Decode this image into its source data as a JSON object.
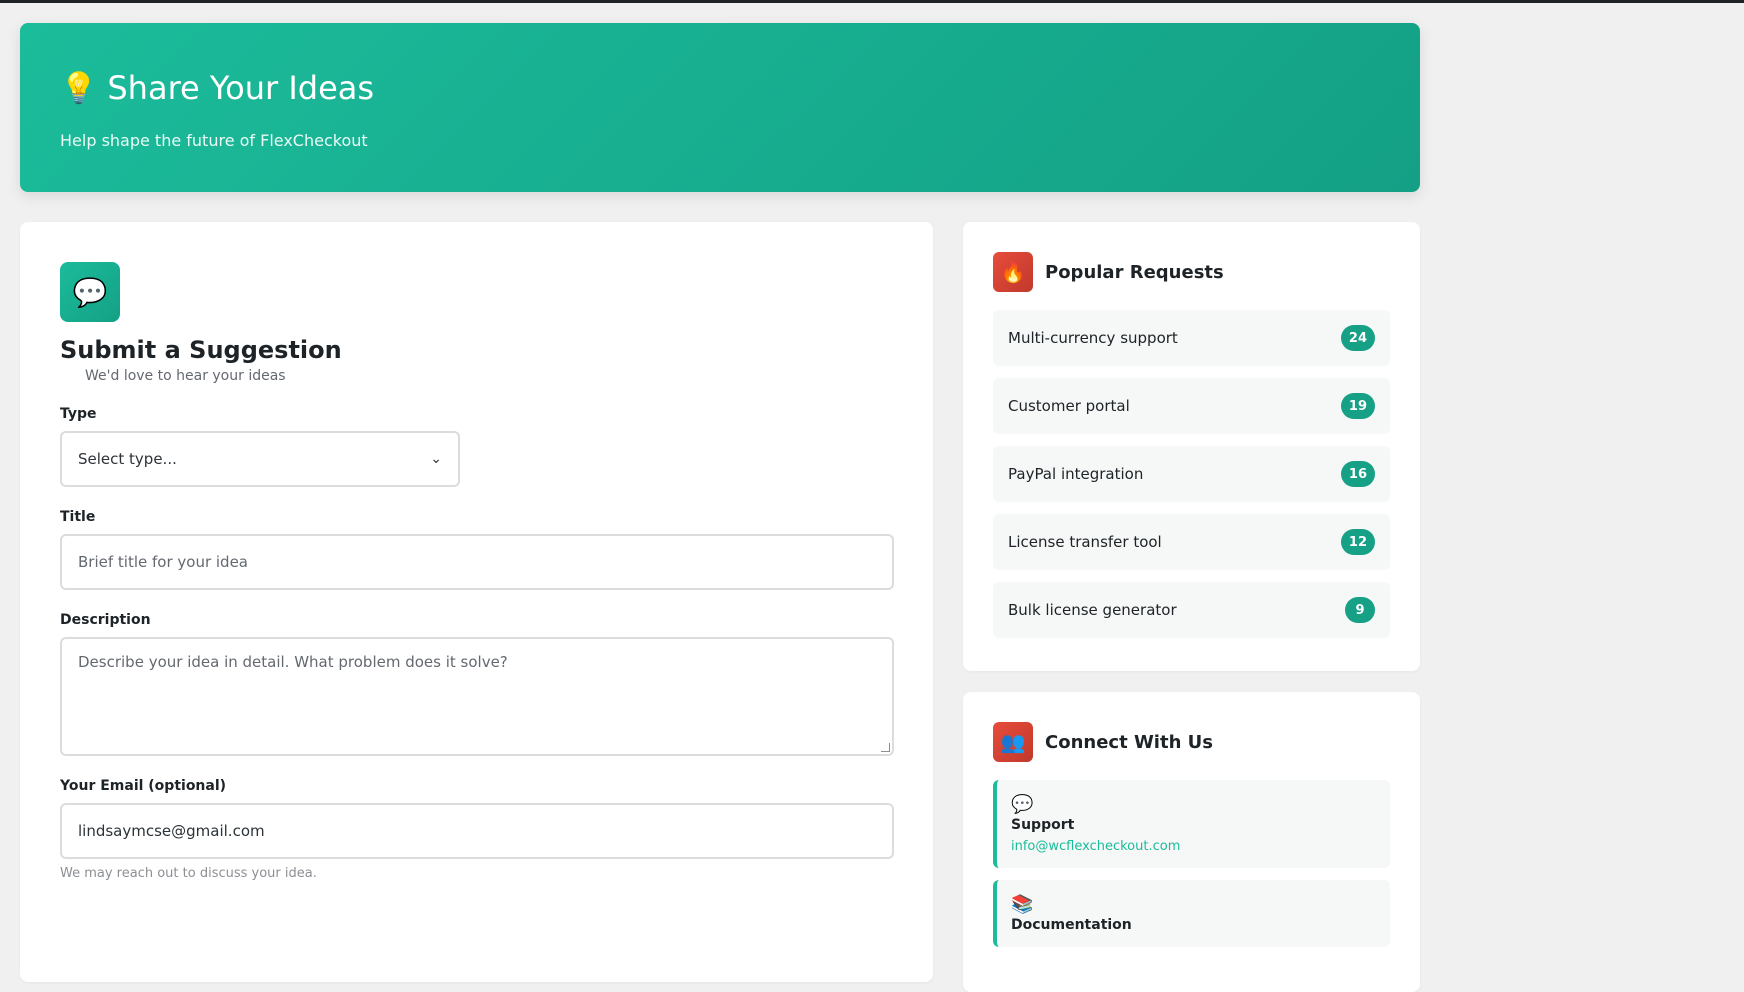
{
  "hero": {
    "emoji": "💡",
    "title": "Share Your Ideas",
    "subtitle": "Help shape the future of FlexCheckout"
  },
  "form": {
    "icon": "💬",
    "heading": "Submit a Suggestion",
    "subheading": "We'd love to hear your ideas",
    "type_label": "Type",
    "type_value": "Select type...",
    "title_label": "Title",
    "title_placeholder": "Brief title for your idea",
    "description_label": "Description",
    "description_placeholder": "Describe your idea in detail. What problem does it solve?",
    "email_label": "Your Email (optional)",
    "email_value": "lindsaymcse@gmail.com",
    "email_help": "We may reach out to discuss your idea."
  },
  "popular": {
    "icon": "🔥",
    "title": "Popular Requests",
    "items": [
      {
        "label": "Multi-currency support",
        "count": "24"
      },
      {
        "label": "Customer portal",
        "count": "19"
      },
      {
        "label": "PayPal integration",
        "count": "16"
      },
      {
        "label": "License transfer tool",
        "count": "12"
      },
      {
        "label": "Bulk license generator",
        "count": "9"
      }
    ]
  },
  "connect": {
    "icon": "👥",
    "title": "Connect With Us",
    "items": [
      {
        "emoji": "💬",
        "name": "Support",
        "link": "info@wcflexcheckout.com"
      },
      {
        "emoji": "📚",
        "name": "Documentation",
        "link": ""
      }
    ]
  },
  "colors": {
    "accent": "#1bbc9b",
    "badge": "#16a085",
    "danger": "#e74c3c"
  }
}
